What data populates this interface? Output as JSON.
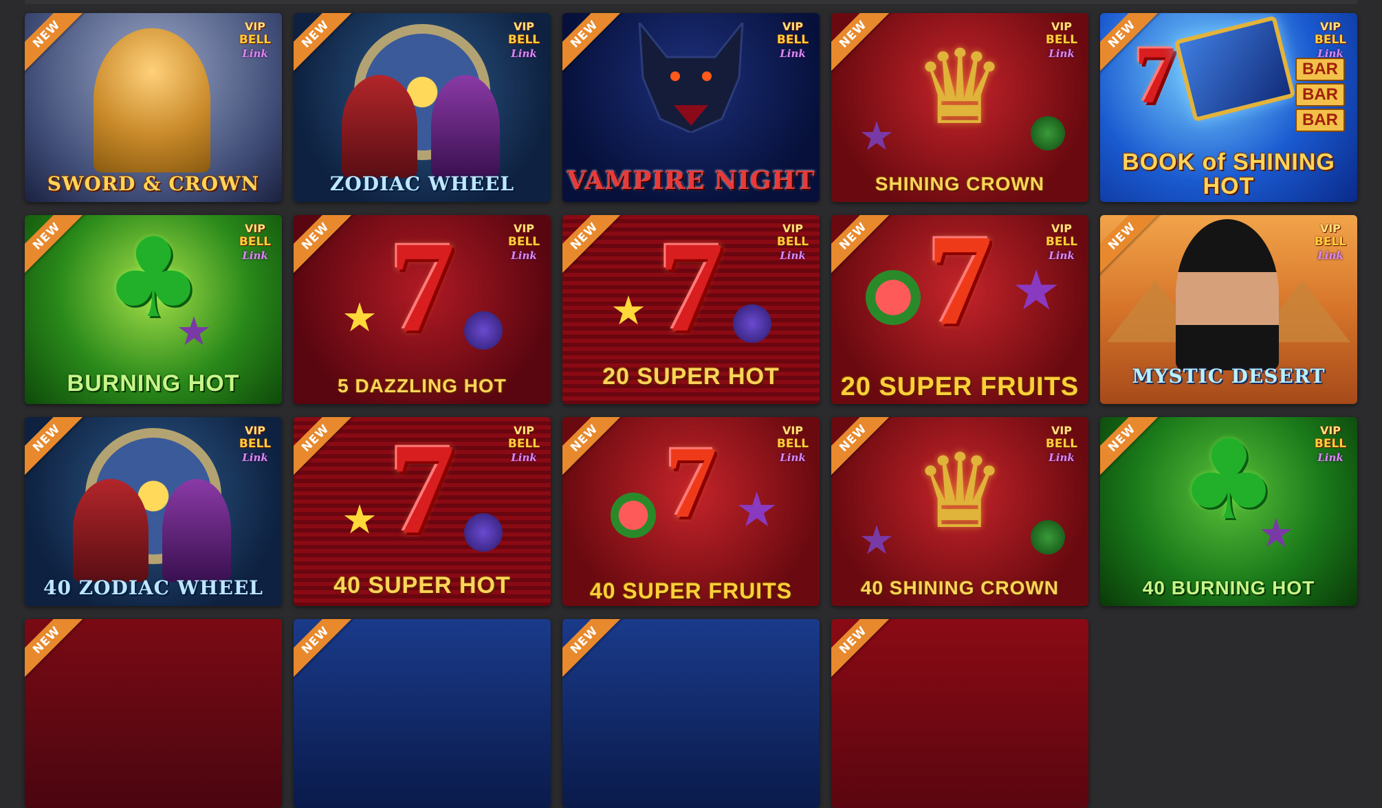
{
  "badge": {
    "new": "NEW",
    "vip": "VIP",
    "bell": "BELL",
    "link": "Link"
  },
  "games": [
    {
      "title": "SWORD & CROWN"
    },
    {
      "title": "ZODIAC WHEEL"
    },
    {
      "title": "VAMPIRE NIGHT"
    },
    {
      "title": "SHINING CROWN"
    },
    {
      "title_line1": "BOOK of SHINING",
      "title_line2": "HOT"
    },
    {
      "title": "BURNING HOT"
    },
    {
      "title": "5 DAZZLING HOT"
    },
    {
      "title": "20 SUPER HOT"
    },
    {
      "title": "20 SUPER FRUITS"
    },
    {
      "title": "MYSTIC DESERT"
    },
    {
      "title": "40 ZODIAC WHEEL"
    },
    {
      "title": "40 SUPER HOT"
    },
    {
      "title": "40 SUPER FRUITS"
    },
    {
      "title": "40 SHINING CROWN"
    },
    {
      "title": "40 BURNING HOT"
    }
  ],
  "colors": {
    "page_bg": "#2b2b2d",
    "new_ribbon": "#e8892d"
  },
  "icons": [
    "seven-symbol-icon",
    "star-icon",
    "crown-icon",
    "clover-icon",
    "wolf-icon",
    "book-icon"
  ]
}
